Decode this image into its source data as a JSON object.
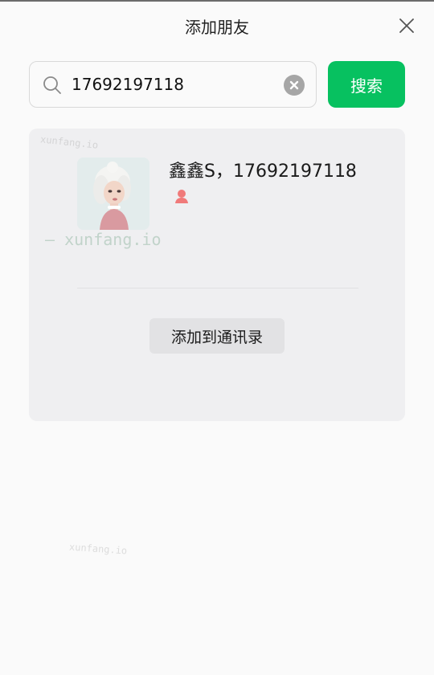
{
  "window": {
    "title": "添加朋友"
  },
  "search": {
    "value": "17692197118",
    "button_label": "搜索"
  },
  "result": {
    "name_line": "鑫鑫S，17692197118",
    "gender": "female",
    "add_button_label": "添加到通讯录"
  },
  "watermarks": [
    "xunfang.io",
    "— xunfang.io",
    "xunfang.io"
  ],
  "colors": {
    "accent_green": "#07c160",
    "card_background": "#efeff1",
    "gender_female": "#f07a7a"
  },
  "icons": {
    "close": "close-icon",
    "search": "search-icon",
    "clear": "clear-icon",
    "gender": "female-gender-icon"
  }
}
